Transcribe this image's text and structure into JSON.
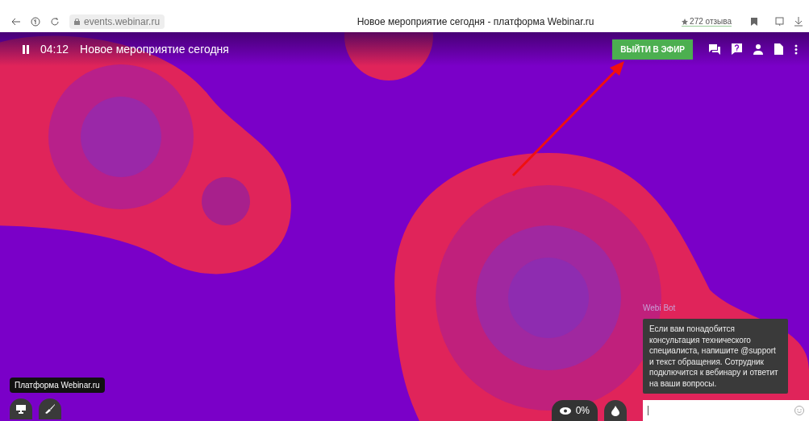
{
  "browser": {
    "url": "events.webinar.ru",
    "tab_title": "Новое мероприятие сегодня - платформа Webinar.ru",
    "rating": "272 отзыва"
  },
  "top_bar": {
    "time": "04:12",
    "title": "Новое мероприятие сегодня",
    "go_live_button": "ВЫЙТИ В ЭФИР"
  },
  "tooltip": "Платформа Webinar.ru",
  "viewers": "0%",
  "chat": {
    "sender": "Webi Bot",
    "message": "Если вам понадобится консультация технического специалиста, напишите @support и текст обращения. Сотрудник подключится к вебинару и ответит на ваши вопросы."
  }
}
